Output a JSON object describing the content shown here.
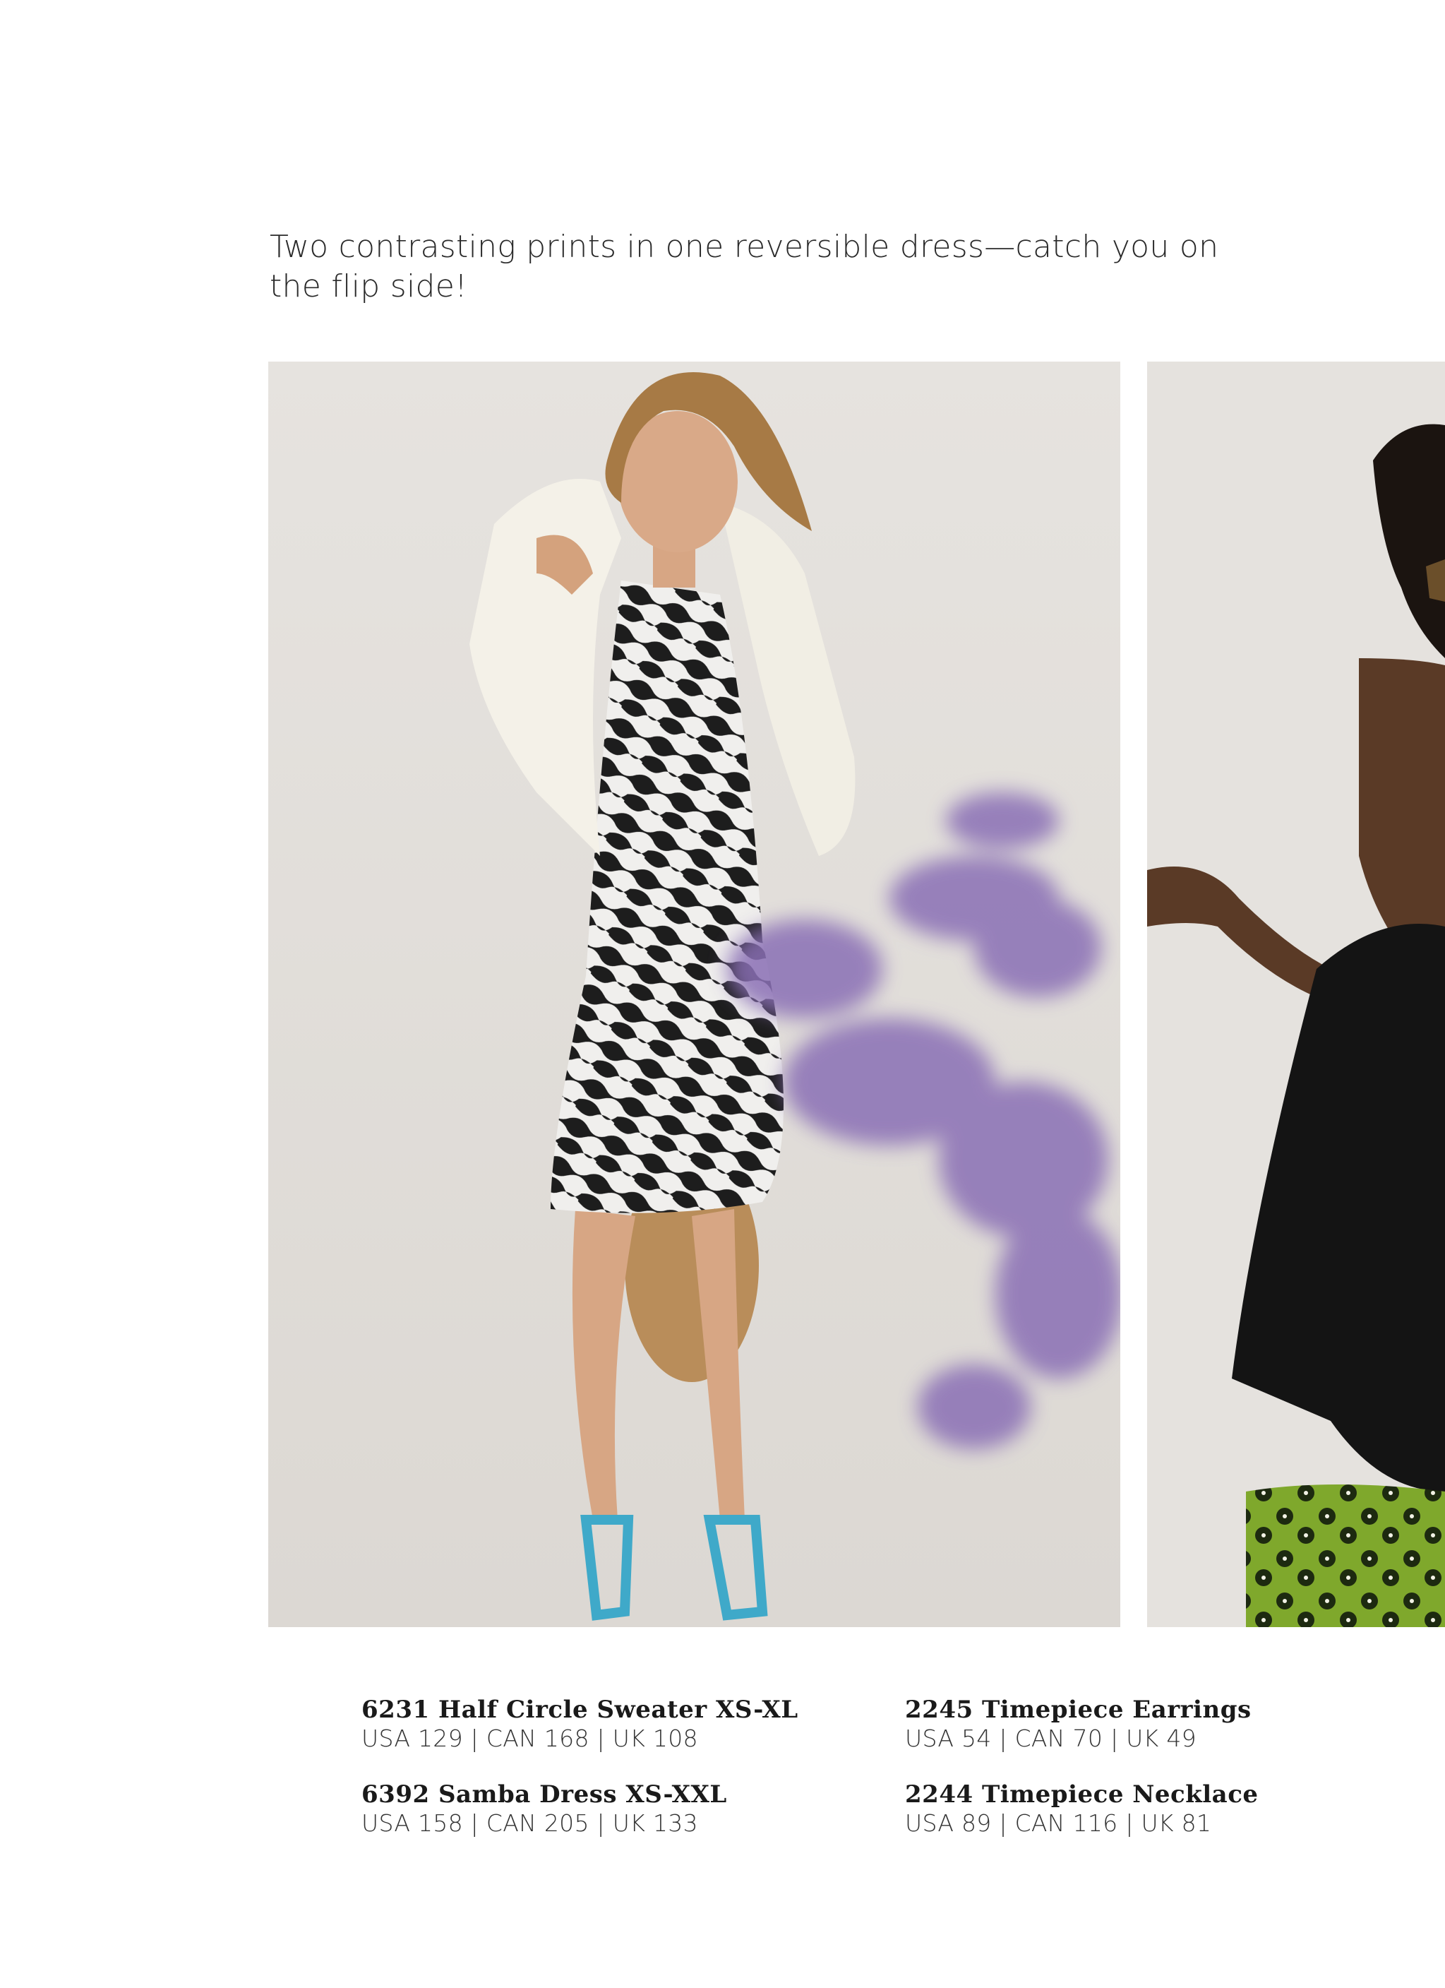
{
  "headline": "Two contrasting prints in one reversible dress—catch you on the flip side!",
  "photos": {
    "left_alt": "model-zebra-dress-cream-sweater",
    "right_alt": "model-black-jacket-green-print"
  },
  "products": {
    "left": [
      {
        "name": "6231 Half Circle Sweater XS-XL",
        "price": "USA 129 | CAN 168 | UK 108"
      },
      {
        "name": "6392 Samba Dress XS-XXL",
        "price": "USA 158 | CAN 205 | UK 133"
      }
    ],
    "right": [
      {
        "name": "2245 Timepiece Earrings",
        "price": "USA 54 | CAN 70 | UK 49"
      },
      {
        "name": "2244 Timepiece Necklace",
        "price": "USA 89 | CAN 116 | UK 81"
      }
    ]
  },
  "colors": {
    "backdrop": "#e4e1dd",
    "text": "#1a1a1a",
    "flower": "#8a6fb5",
    "sandal": "#3fa9c9",
    "green_print": "#7fa82c"
  }
}
